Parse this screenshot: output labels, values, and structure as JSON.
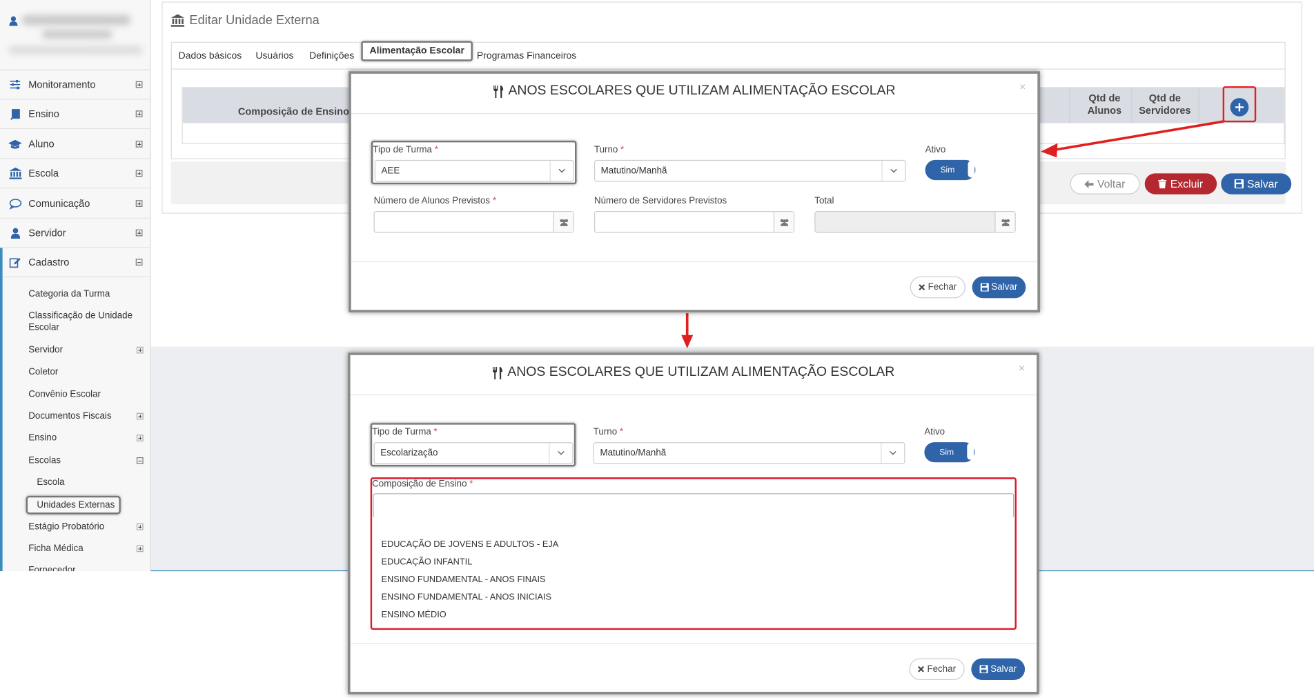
{
  "sidebar": {
    "menu": [
      {
        "label": "Monitoramento",
        "icon": "sliders-icon"
      },
      {
        "label": "Ensino",
        "icon": "book-icon"
      },
      {
        "label": "Aluno",
        "icon": "graduation-cap-icon"
      },
      {
        "label": "Escola",
        "icon": "bank-icon"
      },
      {
        "label": "Comunicação",
        "icon": "chat-icon"
      },
      {
        "label": "Servidor",
        "icon": "user-icon"
      },
      {
        "label": "Cadastro",
        "icon": "edit-icon"
      }
    ],
    "cadastro_items": [
      {
        "label": "Categoria da Turma"
      },
      {
        "label": "Classificação de Unidade Escolar"
      },
      {
        "label": "Servidor"
      },
      {
        "label": "Coletor"
      },
      {
        "label": "Convênio Escolar"
      },
      {
        "label": "Documentos Fiscais"
      },
      {
        "label": "Ensino"
      },
      {
        "label": "Escolas"
      },
      {
        "label": "Escola"
      },
      {
        "label": "Unidades Externas"
      },
      {
        "label": "Estágio Probatório"
      },
      {
        "label": "Ficha Médica"
      },
      {
        "label": "Fornecedor"
      }
    ]
  },
  "page": {
    "title": "Editar Unidade Externa",
    "tabs": [
      {
        "label": "Dados básicos"
      },
      {
        "label": "Usuários"
      },
      {
        "label": "Definições"
      },
      {
        "label": "Alimentação Escolar"
      },
      {
        "label": "Programas Financeiros"
      }
    ],
    "grid_headers": {
      "composicao": "Composição de Ensino",
      "qtd_alunos": "Qtd de Alunos",
      "qtd_servidores": "Qtd de Servidores"
    },
    "buttons": {
      "voltar": "Voltar",
      "excluir": "Excluir",
      "salvar": "Salvar"
    }
  },
  "colors": {
    "primary": "#2f64a8",
    "danger": "#b5282f",
    "highlight": "#e02020"
  },
  "modal1": {
    "title": "ANOS ESCOLARES QUE UTILIZAM ALIMENTAÇÃO ESCOLAR",
    "close": "×",
    "tipo_label": "Tipo de Turma",
    "tipo_value": "AEE",
    "turno_label": "Turno",
    "turno_value": "Matutino/Manhã",
    "ativo_label": "Ativo",
    "ativo_value": "Sim",
    "alunos_label": "Número de Alunos Previstos",
    "servidores_label": "Número de Servidores Previstos",
    "total_label": "Total",
    "fechar": "Fechar",
    "salvar": "Salvar"
  },
  "modal2": {
    "title": "ANOS ESCOLARES QUE UTILIZAM ALIMENTAÇÃO ESCOLAR",
    "close": "×",
    "tipo_label": "Tipo de Turma",
    "tipo_value": "Escolarização",
    "turno_label": "Turno",
    "turno_value": "Matutino/Manhã",
    "ativo_label": "Ativo",
    "ativo_value": "Sim",
    "composicao_label": "Composição de Ensino",
    "options": [
      "EDUCAÇÃO DE JOVENS E ADULTOS - EJA",
      "EDUCAÇÃO INFANTIL",
      "ENSINO FUNDAMENTAL - ANOS FINAIS",
      "ENSINO FUNDAMENTAL - ANOS INICIAIS",
      "ENSINO MÉDIO"
    ],
    "fechar": "Fechar",
    "salvar": "Salvar"
  }
}
